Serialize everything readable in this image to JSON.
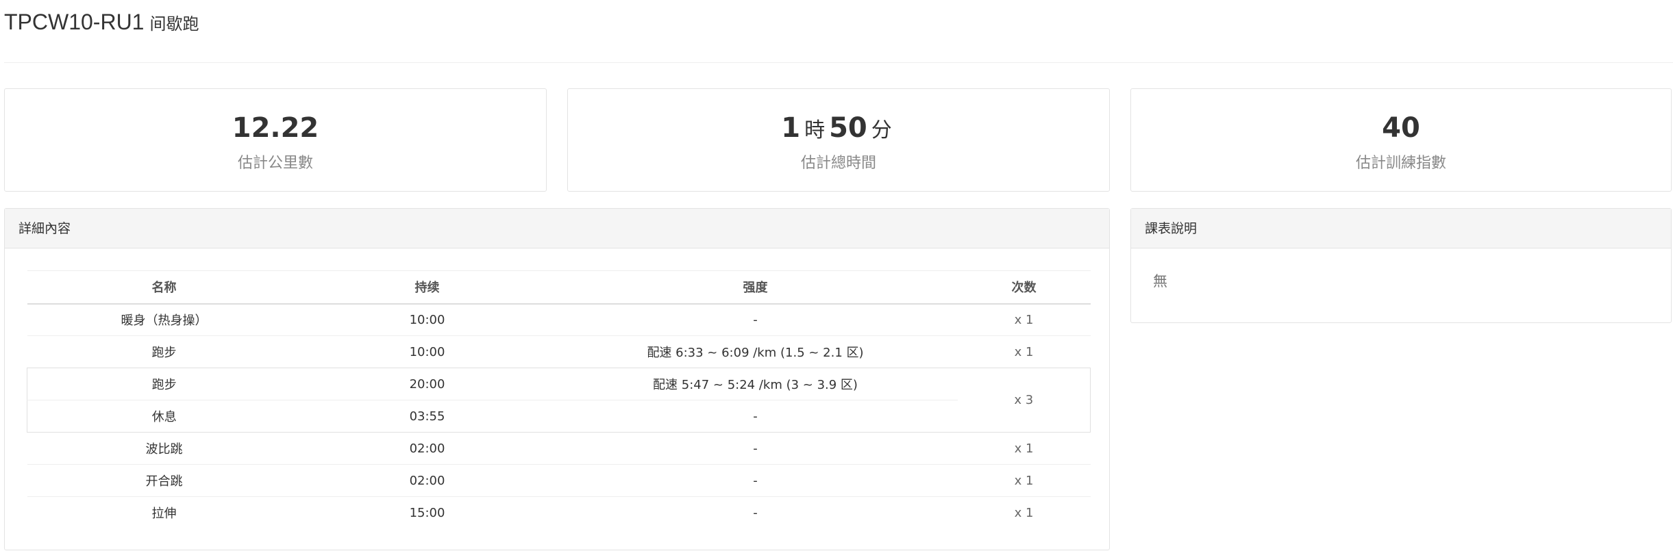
{
  "header": {
    "code": "TPCW10-RU1",
    "subtitle": "间歇跑"
  },
  "stats": {
    "distance": {
      "value": "12.22",
      "label": "估計公里數"
    },
    "duration": {
      "hours": "1",
      "hours_unit": "時",
      "minutes": "50",
      "minutes_unit": "分",
      "label": "估計總時間"
    },
    "training_index": {
      "value": "40",
      "label": "估計訓練指數"
    }
  },
  "detail": {
    "heading": "詳細內容",
    "columns": [
      "名称",
      "持续",
      "强度",
      "次数"
    ],
    "rows": [
      {
        "name": "暖身（热身操）",
        "duration": "10:00",
        "intensity": "-",
        "count": "x 1"
      },
      {
        "name": "跑步",
        "duration": "10:00",
        "intensity": "配速 6:33 ~ 6:09 /km (1.5 ~ 2.1 区)",
        "count": "x 1"
      },
      {
        "name": "跑步",
        "duration": "20:00",
        "intensity": "配速 5:47 ~ 5:24 /km (3 ~ 3.9 区)",
        "count": "x 3"
      },
      {
        "name": "休息",
        "duration": "03:55",
        "intensity": "-"
      },
      {
        "name": "波比跳",
        "duration": "02:00",
        "intensity": "-",
        "count": "x 1"
      },
      {
        "name": "开合跳",
        "duration": "02:00",
        "intensity": "-",
        "count": "x 1"
      },
      {
        "name": "拉伸",
        "duration": "15:00",
        "intensity": "-",
        "count": "x 1"
      }
    ]
  },
  "notes": {
    "heading": "課表說明",
    "body": "無"
  }
}
